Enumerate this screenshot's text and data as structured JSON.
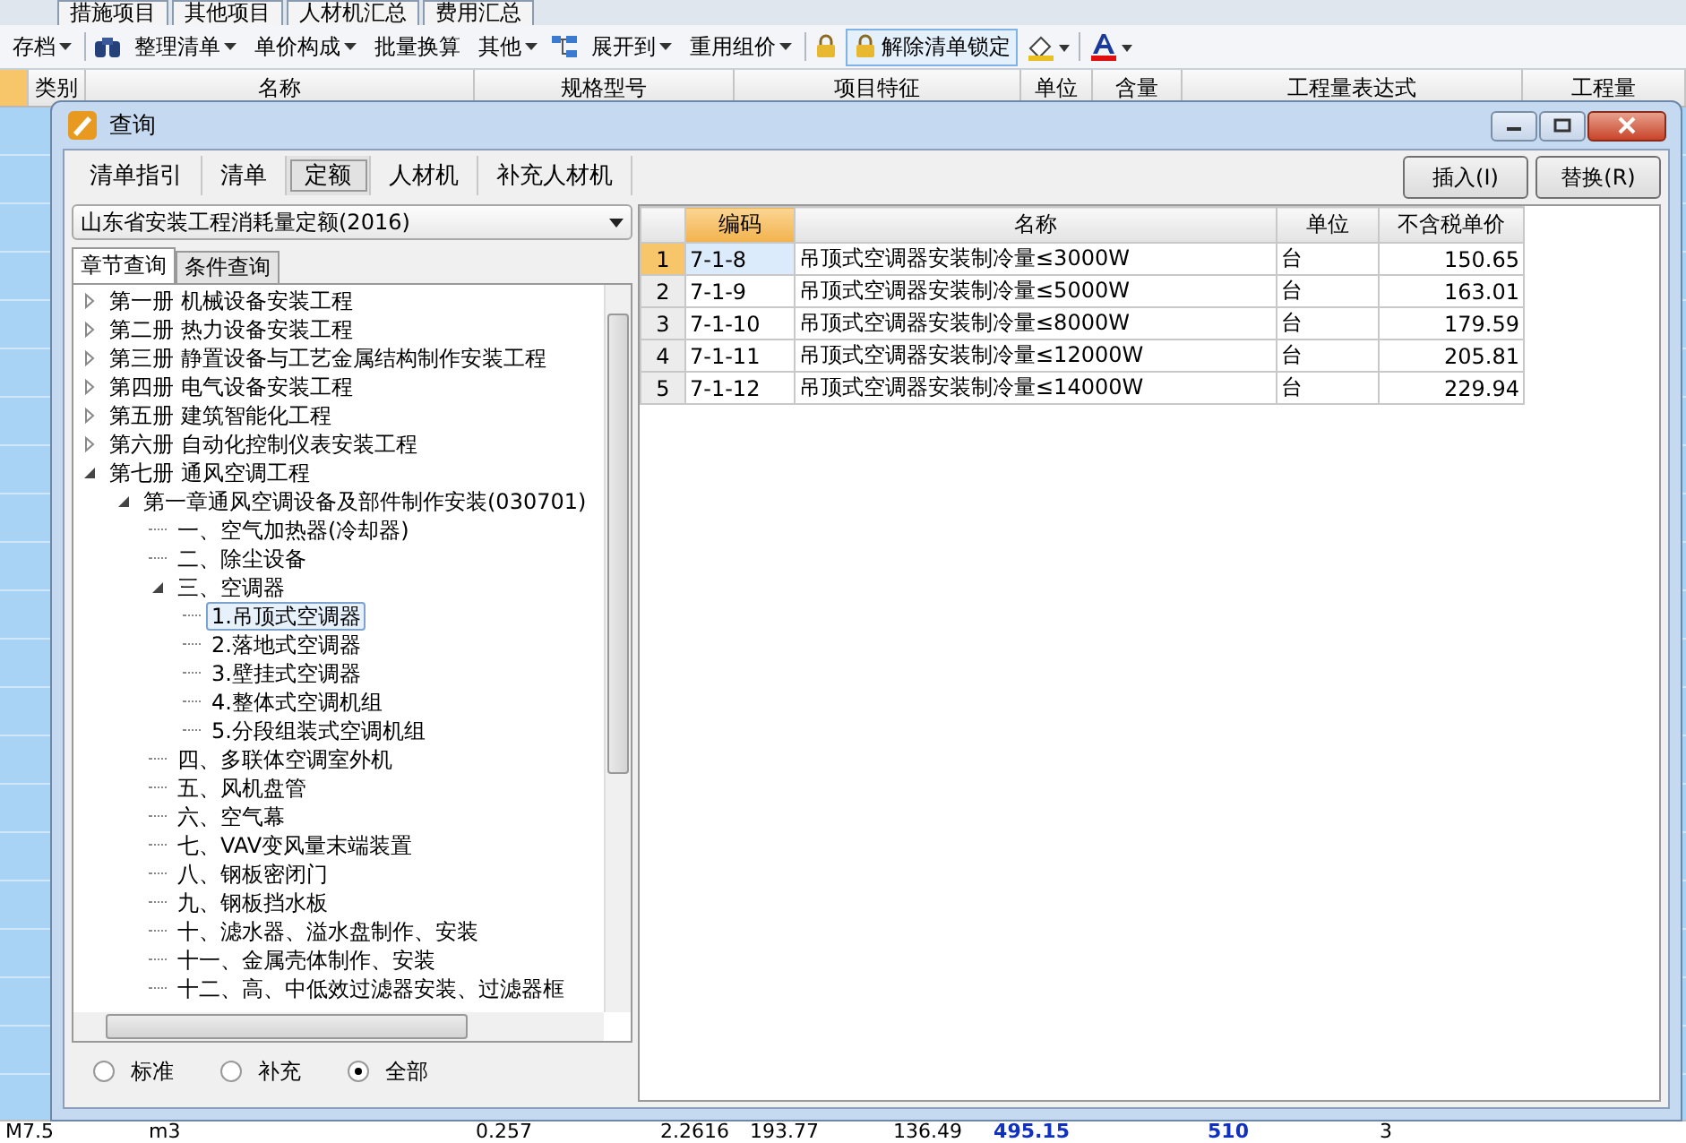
{
  "app": {
    "tabs": [
      "措施项目",
      "其他项目",
      "人材机汇总",
      "费用汇总"
    ],
    "toolbar": [
      {
        "label": "存档",
        "dropdown": true
      },
      {
        "label": "整理清单",
        "dropdown": true
      },
      {
        "label": "单价构成",
        "dropdown": true
      },
      {
        "label": "批量换算",
        "dropdown": false
      },
      {
        "label": "其他",
        "dropdown": true
      },
      {
        "label": "展开到",
        "dropdown": true
      },
      {
        "label": "重用组价",
        "dropdown": true
      },
      {
        "label": "解除清单锁定",
        "dropdown": false
      }
    ],
    "columns": [
      "类别",
      "名称",
      "规格型号",
      "项目特征",
      "单位",
      "含量",
      "工程量表达式",
      "工程量"
    ],
    "bottom_row": [
      "M7.5",
      "m3",
      "0.257",
      "2.2616",
      "193.77",
      "136.49",
      "495.15",
      "510",
      "3"
    ]
  },
  "dialog": {
    "title": "查询",
    "tabs": [
      {
        "label": "清单指引",
        "selected": false
      },
      {
        "label": "清单",
        "selected": false
      },
      {
        "label": "定额",
        "selected": true
      },
      {
        "label": "人材机",
        "selected": false
      },
      {
        "label": "补充人材机",
        "selected": false
      }
    ],
    "library": "山东省安装工程消耗量定额(2016)",
    "subtabs": [
      {
        "label": "章节查询",
        "selected": true
      },
      {
        "label": "条件查询",
        "selected": false
      }
    ],
    "tree": [
      {
        "label": "第一册 机械设备安装工程",
        "expanded": false,
        "selected": false
      },
      {
        "label": "第二册 热力设备安装工程",
        "expanded": false,
        "selected": false
      },
      {
        "label": "第三册 静置设备与工艺金属结构制作安装工程",
        "expanded": false,
        "selected": false
      },
      {
        "label": "第四册 电气设备安装工程",
        "expanded": false,
        "selected": false
      },
      {
        "label": "第五册 建筑智能化工程",
        "expanded": false,
        "selected": false
      },
      {
        "label": "第六册 自动化控制仪表安装工程",
        "expanded": false,
        "selected": false
      },
      {
        "label": "第七册 通风空调工程",
        "expanded": true,
        "selected": false,
        "children": [
          {
            "label": "第一章通风空调设备及部件制作安装(030701)",
            "expanded": true,
            "selected": false,
            "children": [
              {
                "label": "一、空气加热器(冷却器)",
                "selected": false
              },
              {
                "label": "二、除尘设备",
                "selected": false
              },
              {
                "label": "三、空调器",
                "expanded": true,
                "selected": false,
                "children": [
                  {
                    "label": "1.吊顶式空调器",
                    "selected": true
                  },
                  {
                    "label": "2.落地式空调器",
                    "selected": false
                  },
                  {
                    "label": "3.壁挂式空调器",
                    "selected": false
                  },
                  {
                    "label": "4.整体式空调机组",
                    "selected": false
                  },
                  {
                    "label": "5.分段组装式空调机组",
                    "selected": false
                  }
                ]
              },
              {
                "label": "四、多联体空调室外机",
                "selected": false
              },
              {
                "label": "五、风机盘管",
                "selected": false
              },
              {
                "label": "六、空气幕",
                "selected": false
              },
              {
                "label": "七、VAV变风量末端装置",
                "selected": false
              },
              {
                "label": "八、钢板密闭门",
                "selected": false
              },
              {
                "label": "九、钢板挡水板",
                "selected": false
              },
              {
                "label": "十、滤水器、溢水盘制作、安装",
                "selected": false
              },
              {
                "label": "十一、金属壳体制作、安装",
                "selected": false
              },
              {
                "label": "十二、高、中低效过滤器安装、过滤器框",
                "selected": false
              }
            ]
          }
        ]
      }
    ],
    "filters": [
      {
        "label": "标准",
        "selected": false
      },
      {
        "label": "补充",
        "selected": false
      },
      {
        "label": "全部",
        "selected": true
      }
    ],
    "buttons": [
      "插入(I)",
      "替换(R)"
    ],
    "table": {
      "columns": [
        {
          "label": "编码",
          "selected": true
        },
        {
          "label": "名称",
          "selected": false
        },
        {
          "label": "单位",
          "selected": false
        },
        {
          "label": "不含税单价",
          "selected": false
        }
      ],
      "rows": [
        {
          "number": "1",
          "code": "7-1-8",
          "name": "吊顶式空调器安装制冷量≤3000W",
          "unit": "台",
          "price": "150.65",
          "selected": true
        },
        {
          "number": "2",
          "code": "7-1-9",
          "name": "吊顶式空调器安装制冷量≤5000W",
          "unit": "台",
          "price": "163.01",
          "selected": false
        },
        {
          "number": "3",
          "code": "7-1-10",
          "name": "吊顶式空调器安装制冷量≤8000W",
          "unit": "台",
          "price": "179.59",
          "selected": false
        },
        {
          "number": "4",
          "code": "7-1-11",
          "name": "吊顶式空调器安装制冷量≤12000W",
          "unit": "台",
          "price": "205.81",
          "selected": false
        },
        {
          "number": "5",
          "code": "7-1-12",
          "name": "吊顶式空调器安装制冷量≤14000W",
          "unit": "台",
          "price": "229.94",
          "selected": false
        }
      ]
    }
  }
}
